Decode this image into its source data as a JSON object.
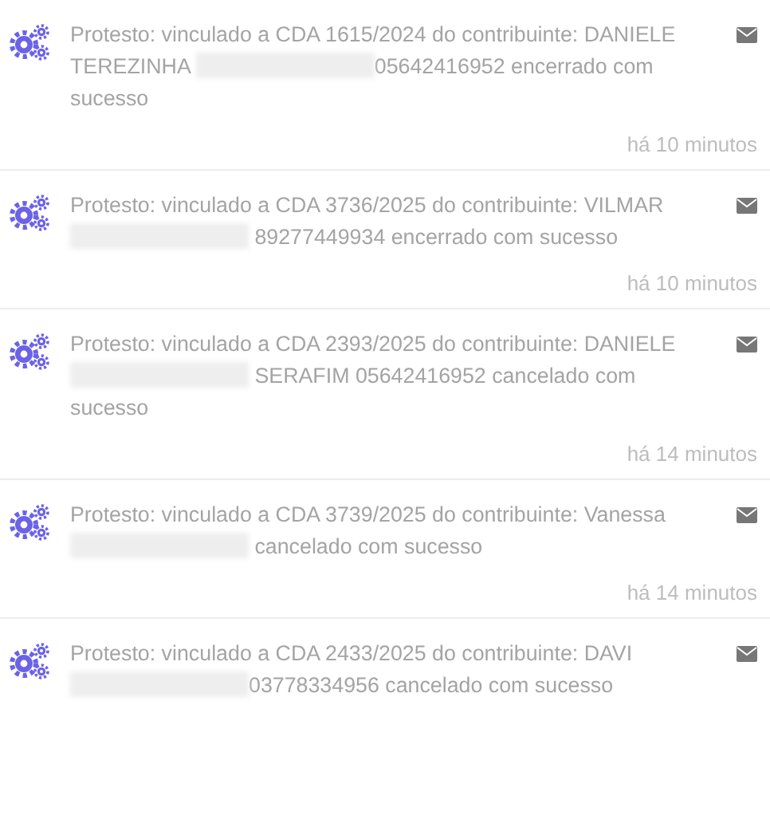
{
  "notifications": [
    {
      "message": [
        {
          "kind": "text",
          "text": "Protesto: vinculado a CDA 1615/2024 do contribuinte: DANIELE TEREZINHA "
        },
        {
          "kind": "redacted"
        },
        {
          "kind": "text",
          "text": "05642416952 encerrado com sucesso"
        }
      ],
      "time": "há 10 minutos"
    },
    {
      "message": [
        {
          "kind": "text",
          "text": "Protesto: vinculado a CDA 3736/2025 do contribuinte: VILMAR "
        },
        {
          "kind": "redacted"
        },
        {
          "kind": "text",
          "text": " 89277449934 encerrado com sucesso"
        }
      ],
      "time": "há 10 minutos"
    },
    {
      "message": [
        {
          "kind": "text",
          "text": "Protesto: vinculado a CDA 2393/2025 do contribuinte: DANIELE "
        },
        {
          "kind": "redacted"
        },
        {
          "kind": "text",
          "text": " SERAFIM 05642416952 cancelado com sucesso"
        }
      ],
      "time": "há 14 minutos"
    },
    {
      "message": [
        {
          "kind": "text",
          "text": "Protesto: vinculado a CDA 3739/2025 do contribuinte: Vanessa "
        },
        {
          "kind": "redacted"
        },
        {
          "kind": "text",
          "text": " cancelado com sucesso"
        }
      ],
      "time": "há 14 minutos"
    },
    {
      "message": [
        {
          "kind": "text",
          "text": "Protesto: vinculado a CDA 2433/2025 do contribuinte: DAVI "
        },
        {
          "kind": "redacted"
        },
        {
          "kind": "text",
          "text": "03778334956 cancelado com sucesso"
        }
      ]
    }
  ]
}
